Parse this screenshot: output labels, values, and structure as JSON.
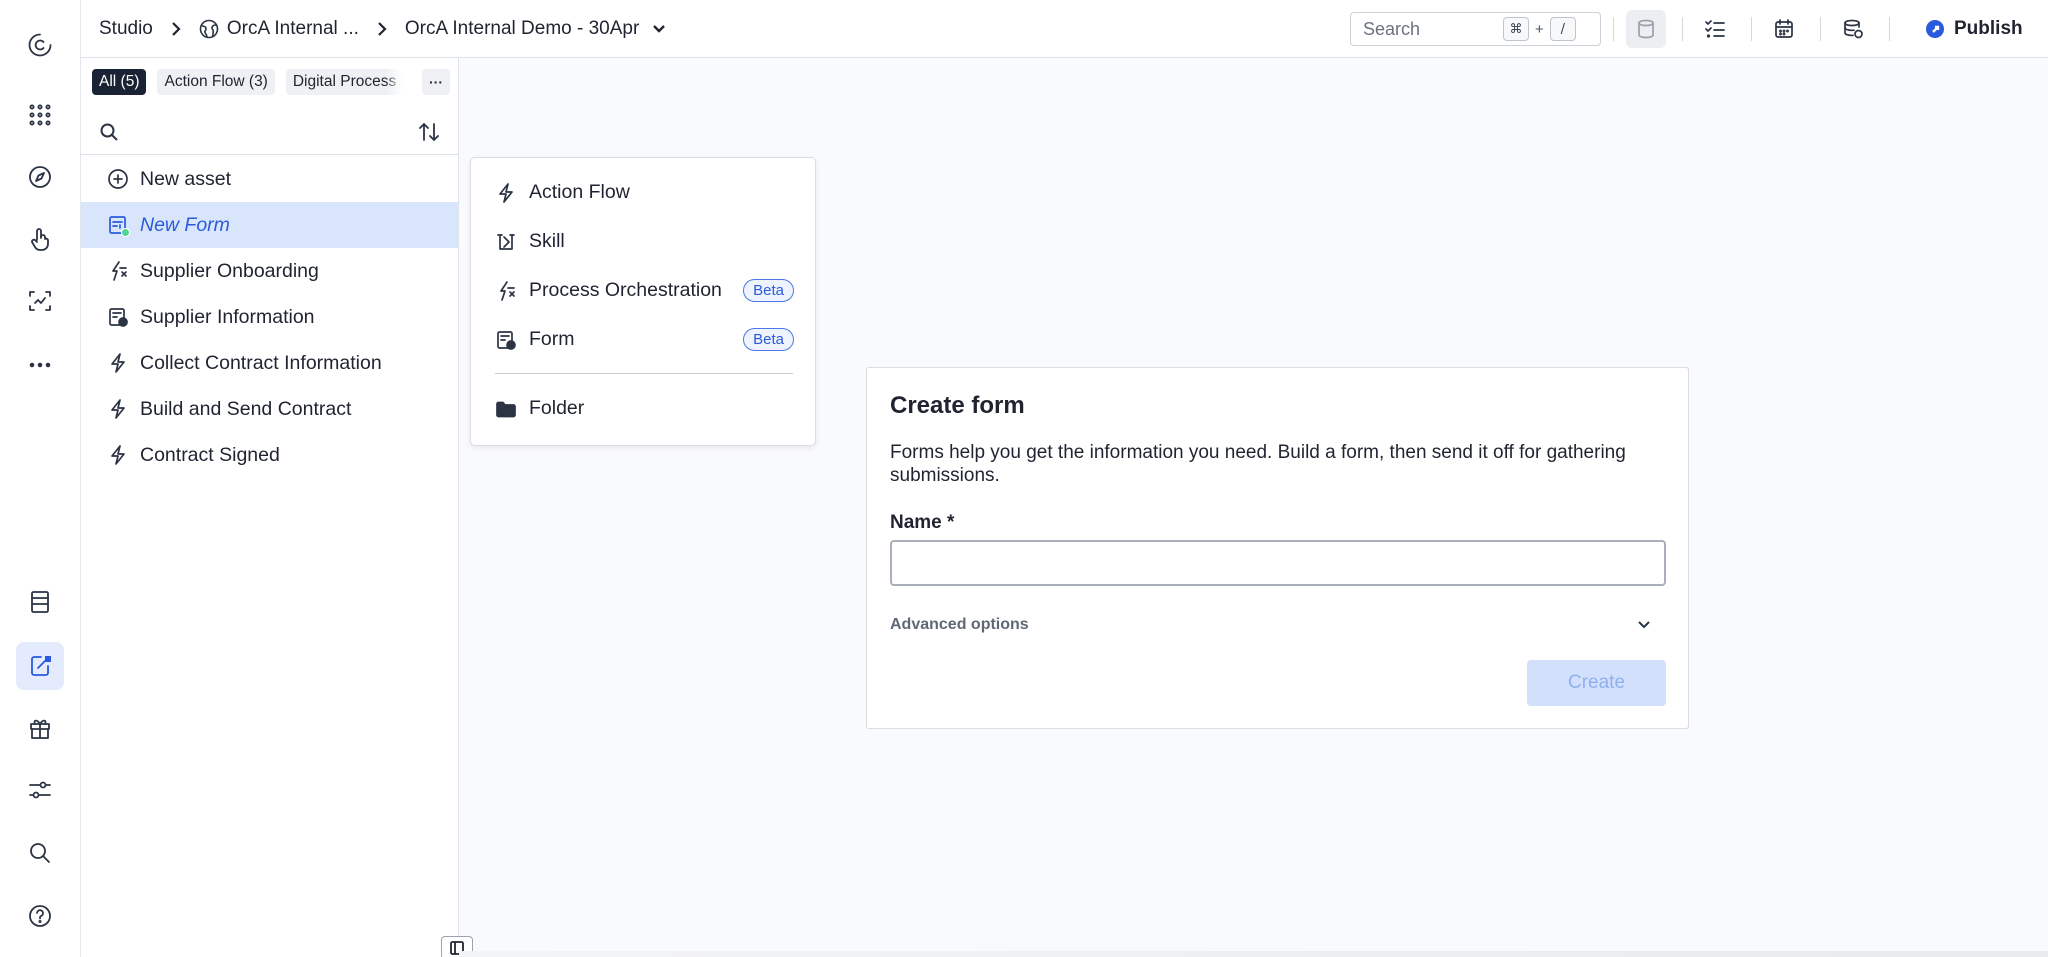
{
  "colors": {
    "accent": "#2a5bdd",
    "selected_row": "#d9e5fb",
    "chip_active": "#1a2333",
    "status_dot": "#4fd59a"
  },
  "rail": {
    "top_icons": [
      "logo-icon",
      "apps-grid-icon",
      "compass-icon",
      "touch-icon",
      "scan-icon",
      "more-icon"
    ],
    "bottom_icons": [
      "table-icon",
      "studio-icon",
      "gift-icon",
      "sliders-icon",
      "search-icon",
      "help-icon"
    ],
    "active": "studio-icon"
  },
  "breadcrumb": {
    "studio": "Studio",
    "workspace": "OrcA Internal ...",
    "project": "OrcA Internal Demo - 30Apr"
  },
  "topbar": {
    "search_placeholder": "Search",
    "shortcut_cmd": "⌘",
    "shortcut_plus": "+",
    "shortcut_key": "/",
    "icons": [
      "database-icon",
      "checklist-icon",
      "calendar-icon",
      "settings-db-icon"
    ],
    "publish_label": "Publish"
  },
  "panel": {
    "chips": [
      {
        "label": "All (5)",
        "active": true
      },
      {
        "label": "Action Flow (3)",
        "active": false
      },
      {
        "label": "Digital Process",
        "active": false
      }
    ],
    "more_label": "···",
    "assets": [
      {
        "label": "New asset",
        "icon": "plus-circle-icon"
      },
      {
        "label": "New Form",
        "icon": "form-icon",
        "selected": true
      },
      {
        "label": "Supplier Onboarding",
        "icon": "process-icon"
      },
      {
        "label": "Supplier Information",
        "icon": "form-icon"
      },
      {
        "label": "Collect Contract Information",
        "icon": "bolt-icon"
      },
      {
        "label": "Build and Send Contract",
        "icon": "bolt-icon"
      },
      {
        "label": "Contract Signed",
        "icon": "bolt-icon"
      }
    ]
  },
  "menu": {
    "items": [
      {
        "label": "Action Flow",
        "icon": "bolt-icon"
      },
      {
        "label": "Skill",
        "icon": "skill-icon"
      },
      {
        "label": "Process Orchestration",
        "icon": "process-icon",
        "badge": "Beta"
      },
      {
        "label": "Form",
        "icon": "form-icon",
        "badge": "Beta"
      },
      {
        "label": "Folder",
        "icon": "folder-icon"
      }
    ]
  },
  "create_form": {
    "title": "Create form",
    "description": "Forms help you get the information you need. Build a form, then send it off for gathering submissions.",
    "name_label": "Name *",
    "name_value": "",
    "advanced_label": "Advanced options",
    "create_label": "Create"
  }
}
